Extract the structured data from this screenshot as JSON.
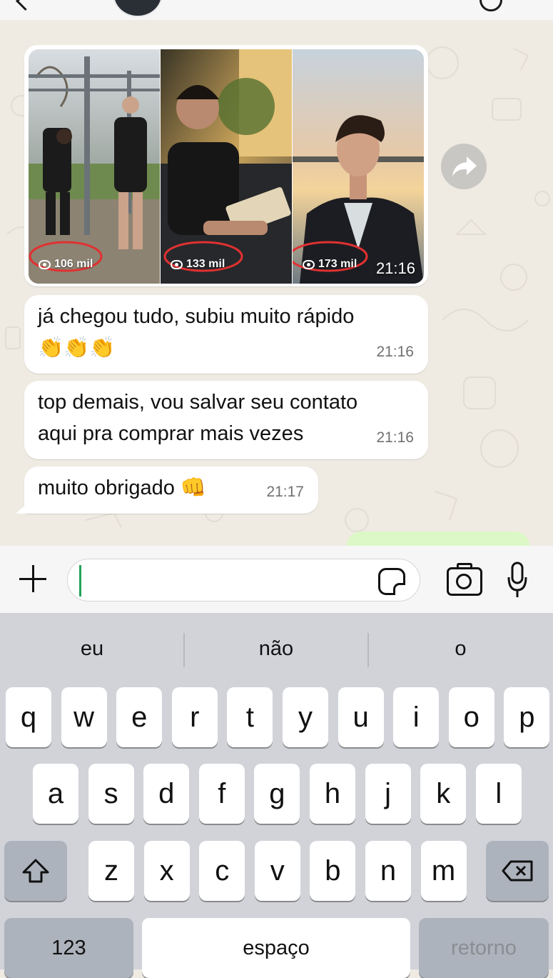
{
  "chat": {
    "media": {
      "views": [
        "106 mil",
        "133 mil",
        "173 mil"
      ],
      "time": "21:16"
    },
    "messages": [
      {
        "text": "já chegou tudo, subiu muito rápido\n👏👏👏",
        "time": "21:16"
      },
      {
        "text": "top demais, vou salvar seu contato\naqui pra comprar mais vezes",
        "time": "21:16"
      },
      {
        "text": "muito obrigado 👊",
        "time": "21:17"
      }
    ]
  },
  "keyboard": {
    "suggestions": [
      "eu",
      "não",
      "o"
    ],
    "row1": [
      "q",
      "w",
      "e",
      "r",
      "t",
      "y",
      "u",
      "i",
      "o",
      "p"
    ],
    "row2": [
      "a",
      "s",
      "d",
      "f",
      "g",
      "h",
      "j",
      "k",
      "l"
    ],
    "row3": [
      "z",
      "x",
      "c",
      "v",
      "b",
      "n",
      "m"
    ],
    "numbers_label": "123",
    "space_label": "espaço",
    "return_label": "retorno"
  },
  "colors": {
    "chat_background": "#efeae2",
    "outgoing_bubble": "#dcf8c6",
    "annotation_circle": "#e03131",
    "cursor": "#25a35a"
  },
  "icons": [
    "back-icon",
    "avatar",
    "call-icon",
    "forward-icon",
    "eye-icon",
    "plus-icon",
    "sticker-icon",
    "camera-icon",
    "microphone-icon",
    "shift-icon",
    "backspace-icon"
  ]
}
